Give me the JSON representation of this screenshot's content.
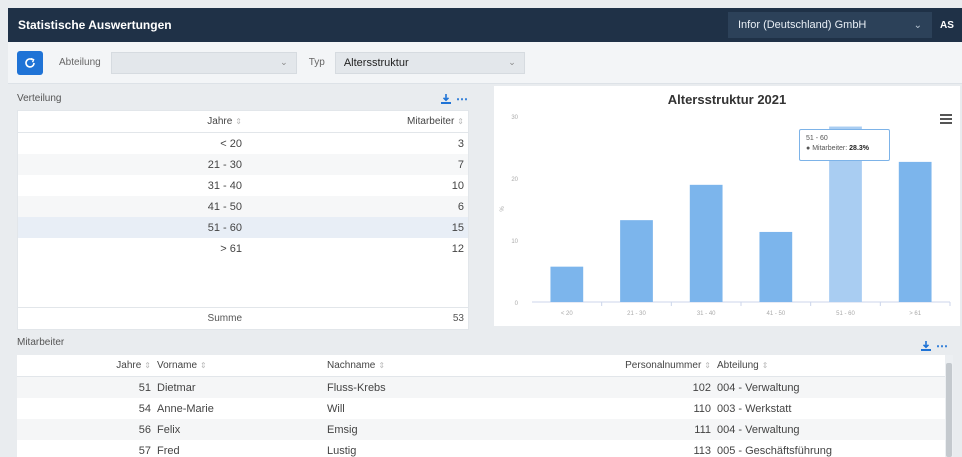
{
  "app": {
    "title": "Statistische Auswertungen",
    "company": "Infor (Deutschland) GmbH",
    "user": "AS"
  },
  "filters": {
    "refresh_icon": "refresh-icon",
    "abteilung_label": "Abteilung",
    "abteilung_value": "",
    "typ_label": "Typ",
    "typ_value": "Altersstruktur"
  },
  "verteilung": {
    "label": "Verteilung",
    "columns": {
      "jahre": "Jahre",
      "mitarbeiter": "Mitarbeiter"
    },
    "rows": [
      {
        "jahre": "< 20",
        "mitarbeiter": "3"
      },
      {
        "jahre": "21 - 30",
        "mitarbeiter": "7"
      },
      {
        "jahre": "31 - 40",
        "mitarbeiter": "10"
      },
      {
        "jahre": "41 - 50",
        "mitarbeiter": "6"
      },
      {
        "jahre": "51 - 60",
        "mitarbeiter": "15"
      },
      {
        "jahre": "> 61",
        "mitarbeiter": "12"
      }
    ],
    "summe_label": "Summe",
    "summe_value": "53"
  },
  "chart_data": {
    "type": "bar",
    "title": "Altersstruktur 2021",
    "categories": [
      "< 20",
      "21 - 30",
      "31 - 40",
      "41 - 50",
      "51 - 60",
      "> 61"
    ],
    "values": [
      5.7,
      13.2,
      18.9,
      11.3,
      28.3,
      22.6
    ],
    "ylim": [
      0,
      30
    ],
    "yticks": [
      "0",
      "10",
      "20",
      "30"
    ],
    "ylabel": "%",
    "color": "#7cb5ec",
    "highlight_color": "#a9cdf2",
    "grid": false,
    "tooltip": {
      "category": "51 - 60",
      "series_label": "Mitarbeiter:",
      "value": "28.3%"
    }
  },
  "mitarbeiter": {
    "label": "Mitarbeiter",
    "columns": {
      "jahre": "Jahre",
      "vorname": "Vorname",
      "nachname": "Nachname",
      "personalnummer": "Personalnummer",
      "abteilung": "Abteilung"
    },
    "rows": [
      {
        "jahre": "51",
        "vorname": "Dietmar",
        "nachname": "Fluss-Krebs",
        "personalnummer": "102",
        "abteilung": "004 - Verwaltung"
      },
      {
        "jahre": "54",
        "vorname": "Anne-Marie",
        "nachname": "Will",
        "personalnummer": "110",
        "abteilung": "003 - Werkstatt"
      },
      {
        "jahre": "56",
        "vorname": "Felix",
        "nachname": "Emsig",
        "personalnummer": "111",
        "abteilung": "004 - Verwaltung"
      },
      {
        "jahre": "57",
        "vorname": "Fred",
        "nachname": "Lustig",
        "personalnummer": "113",
        "abteilung": "005 - Geschäftsführung"
      }
    ]
  }
}
